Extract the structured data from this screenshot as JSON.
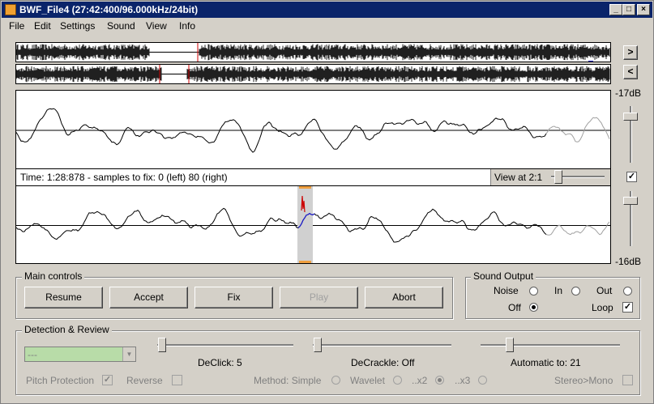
{
  "window": {
    "title": "BWF_File4 (27:42:400/96.000kHz/24bit)"
  },
  "menu": [
    "File",
    "Edit",
    "Settings",
    "Sound",
    "View",
    "Info"
  ],
  "nav": {
    "forward": ">",
    "back": "<"
  },
  "levels": {
    "top": "-17dB",
    "bottom": "-16dB"
  },
  "status": {
    "text": "Time: 1:28:878 - samples to fix: 0 (left) 80 (right)",
    "view_label": "View at 2:1"
  },
  "main_controls": {
    "label": "Main controls",
    "buttons": [
      "Resume",
      "Accept",
      "Fix",
      "Play",
      "Abort"
    ]
  },
  "sound_output": {
    "label": "Sound Output",
    "noise": "Noise",
    "in": "In",
    "out": "Out",
    "off": "Off",
    "loop": "Loop"
  },
  "detection": {
    "label": "Detection & Review",
    "combo_value": "---",
    "declick": "DeClick: 5",
    "decrackle": "DeCrackle: Off",
    "automatic": "Automatic to: 21",
    "pitch_protection": "Pitch Protection",
    "reverse": "Reverse",
    "method": "Method: Simple",
    "wavelet": "Wavelet",
    "x2": "..x2",
    "x3": "..x3",
    "stereo_mono": "Stereo>Mono"
  },
  "colors": {
    "title_bar": "#0a246a",
    "wave_marker": "#cc0000",
    "repair_blue": "#1a1ad0",
    "combo_green": "#b8dca8"
  }
}
